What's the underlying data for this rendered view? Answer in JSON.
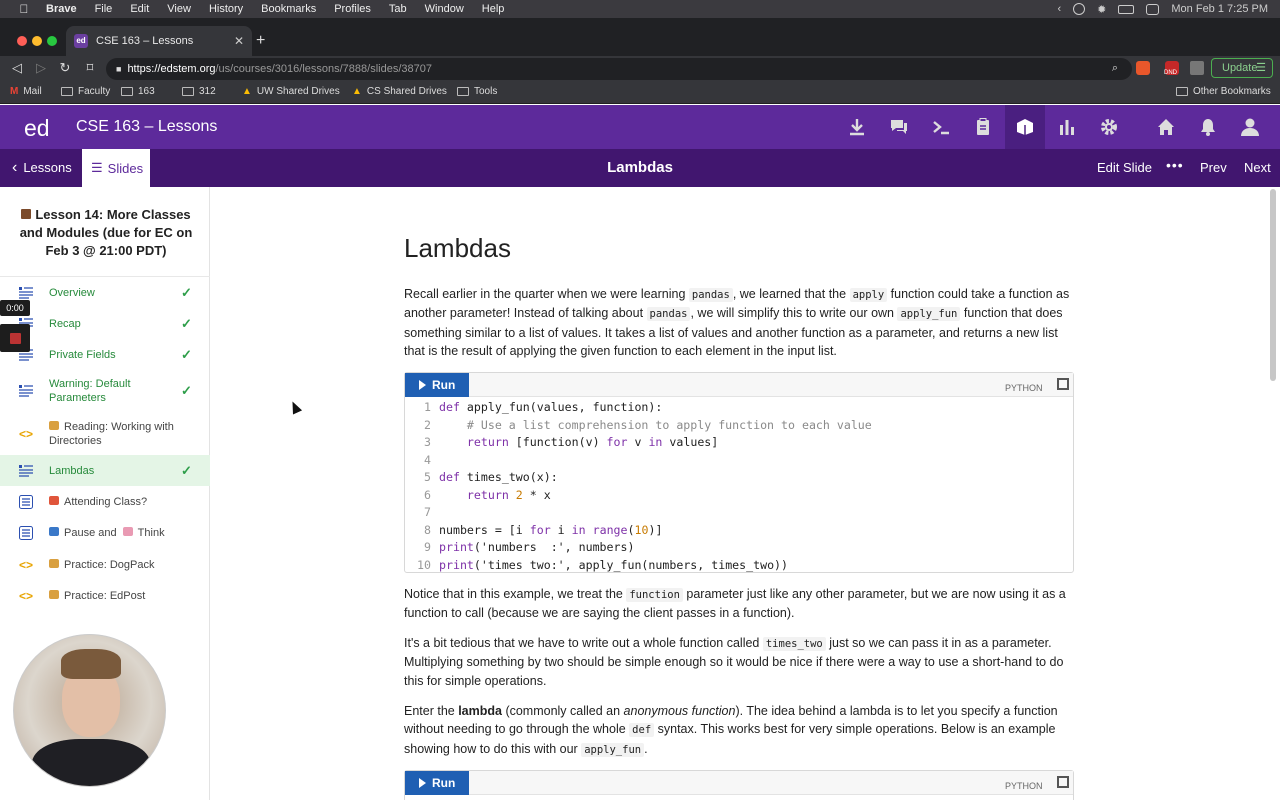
{
  "mac_menu": {
    "app": "Brave",
    "items": [
      "File",
      "Edit",
      "View",
      "History",
      "Bookmarks",
      "Profiles",
      "Tab",
      "Window",
      "Help"
    ],
    "clock": "Mon Feb 1  7:25 PM"
  },
  "browser": {
    "tab_title": "CSE 163 – Lessons",
    "favicon": "ed",
    "url_host": "https://edstem.org",
    "url_path": "/us/courses/3016/lessons/7888/slides/38707",
    "update_label": "Update",
    "ext_badge": "DND",
    "bookmarks": [
      {
        "label": "Mail"
      },
      {
        "label": "Faculty"
      },
      {
        "label": "163"
      },
      {
        "label": "312"
      },
      {
        "label": "UW Shared Drives"
      },
      {
        "label": "CS Shared Drives"
      },
      {
        "label": "Tools"
      }
    ],
    "other_bookmarks": "Other Bookmarks"
  },
  "ed": {
    "logo": "ed",
    "title": "CSE 163 – Lessons",
    "header_icons": [
      "download-icon",
      "chat-icon",
      "terminal-icon",
      "clipboard-icon",
      "lessons-icon",
      "chart-icon",
      "gear-icon",
      "home-icon",
      "bell-icon",
      "user-icon"
    ]
  },
  "subheader": {
    "lessons": "Lessons",
    "slides": "Slides",
    "slide_title": "Lambdas",
    "edit_slide": "Edit Slide",
    "more": "•••",
    "prev": "Prev",
    "next": "Next"
  },
  "sidebar": {
    "lesson_title": "Lesson 14: More Classes and Modules (due for EC on Feb 3 @ 21:00 PDT)",
    "items": [
      {
        "label": "Overview",
        "type": "doc",
        "done": true
      },
      {
        "label": "Recap",
        "type": "doc",
        "done": true
      },
      {
        "label": "Private Fields",
        "type": "doc",
        "done": true
      },
      {
        "label": "Warning: Default Parameters",
        "type": "doc",
        "done": true
      },
      {
        "label": "Reading: Working with Directories",
        "type": "code",
        "done": false
      },
      {
        "label": "Lambdas",
        "type": "doc",
        "done": true,
        "active": true
      },
      {
        "label": "Attending Class?",
        "type": "quiz",
        "done": false
      },
      {
        "label": "Pause and",
        "label_suffix": "Think",
        "type": "quiz",
        "done": false
      },
      {
        "label": "Practice: DogPack",
        "type": "code",
        "done": false
      },
      {
        "label": "Practice: EdPost",
        "type": "code",
        "done": false
      }
    ]
  },
  "overlay": {
    "timer": "0:00"
  },
  "content": {
    "title": "Lambdas",
    "p1": [
      "Recall earlier in the quarter when we were learning ",
      "pandas",
      ", we learned that the ",
      "apply",
      " function could take a function as another parameter! Instead of talking about ",
      "pandas",
      ", we will simplify this to write our own ",
      "apply_fun",
      " function that does something similar to a list of values. It takes a list of values and another function as a parameter, and returns a new list that is the result of applying the given function to each element in the input list."
    ],
    "run_label": "Run",
    "lang": "PYTHON",
    "code_lines": [
      {
        "n": "1",
        "text": "def apply_fun(values, function):"
      },
      {
        "n": "2",
        "text": "    # Use a list comprehension to apply function to each value"
      },
      {
        "n": "3",
        "text": "    return [function(v) for v in values]"
      },
      {
        "n": "4",
        "text": ""
      },
      {
        "n": "5",
        "text": "def times_two(x):"
      },
      {
        "n": "6",
        "text": "    return 2 * x"
      },
      {
        "n": "7",
        "text": ""
      },
      {
        "n": "8",
        "text": "numbers = [i for i in range(10)]"
      },
      {
        "n": "9",
        "text": "print('numbers  :', numbers)"
      },
      {
        "n": "10",
        "text": "print('times two:', apply_fun(numbers, times_two))"
      }
    ],
    "p2": [
      "Notice that in this example, we treat the ",
      "function",
      " parameter just like any other parameter, but we are now using it as a function to call (because we are saying the client passes in a function)."
    ],
    "p3": [
      "It's a bit tedious that we have to write out a whole function called ",
      "times_two",
      " just so we can pass it in as a parameter. Multiplying something by two should be simple enough so it would be nice if there were a way to use a short-hand to do this for simple operations."
    ],
    "p4": [
      "Enter the ",
      "lambda",
      " (commonly called an ",
      "anonymous function",
      "). The idea behind a lambda is to let you specify a function without needing to go through the whole ",
      "def",
      " syntax. This works best for very simple operations. Below is an example showing how to do this with our ",
      "apply_fun",
      "."
    ],
    "run_label2": "Run",
    "lang2": "PYTHON"
  }
}
